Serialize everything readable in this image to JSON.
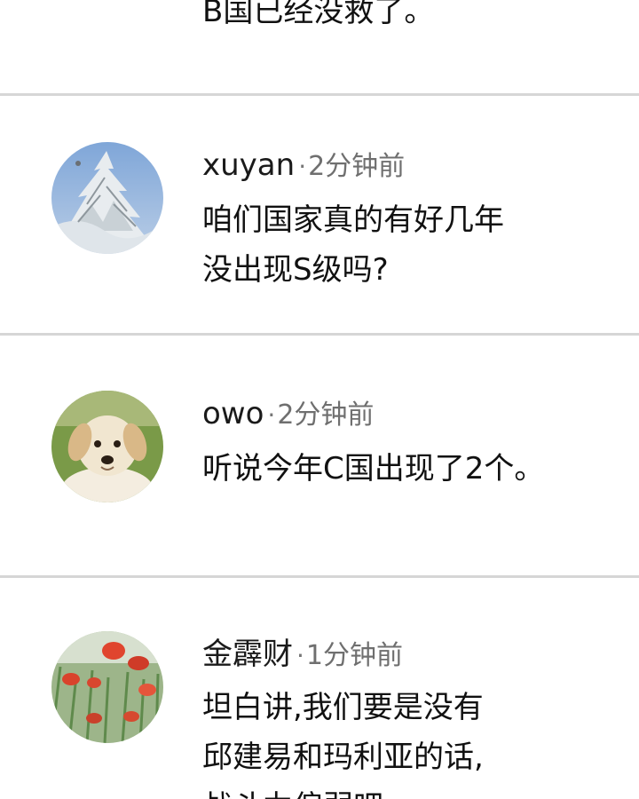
{
  "previous_comment": {
    "text_tail": "B国已经没救了。"
  },
  "comments": [
    {
      "username": "xuyan",
      "separator": "·",
      "time": "2分钟前",
      "avatar_icon": "snowy-tree-avatar-icon",
      "lines": [
        "咱们国家真的有好几年",
        "没出现S级吗?"
      ]
    },
    {
      "username": "owo",
      "separator": "·",
      "time": "2分钟前",
      "avatar_icon": "puppy-avatar-icon",
      "lines": [
        "听说今年C国出现了2个。"
      ]
    },
    {
      "username": "金霹财",
      "separator": "·",
      "time": "1分钟前",
      "avatar_icon": "poppy-flowers-avatar-icon",
      "lines": [
        "坦白讲,我们要是没有",
        "邱建易和玛利亚的话,",
        "战斗力偏弱吧"
      ]
    }
  ],
  "colors": {
    "divider": "#d6d6d6",
    "text": "#111111",
    "meta": "#6f6f6f"
  }
}
